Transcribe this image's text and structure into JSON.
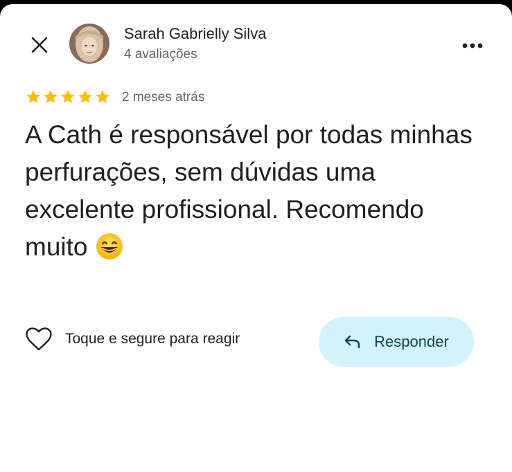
{
  "author": {
    "name": "Sarah Gabrielly Silva",
    "review_count": "4 avaliações"
  },
  "review": {
    "rating": 5,
    "max_rating": 5,
    "date": "2 meses atrás",
    "text": "A Cath é responsável por todas minhas perfurações, sem dúvidas uma excelente profissional. Recomendo muito",
    "emoji_icon": "grinning-face-emoji"
  },
  "actions": {
    "react_label": "Toque e segure para reagir",
    "reply_label": "Responder"
  },
  "colors": {
    "star": "#fbbc04",
    "reply_button_bg": "#d3f3fb",
    "reply_button_text": "#0b4452",
    "secondary_text": "#5f6368"
  }
}
